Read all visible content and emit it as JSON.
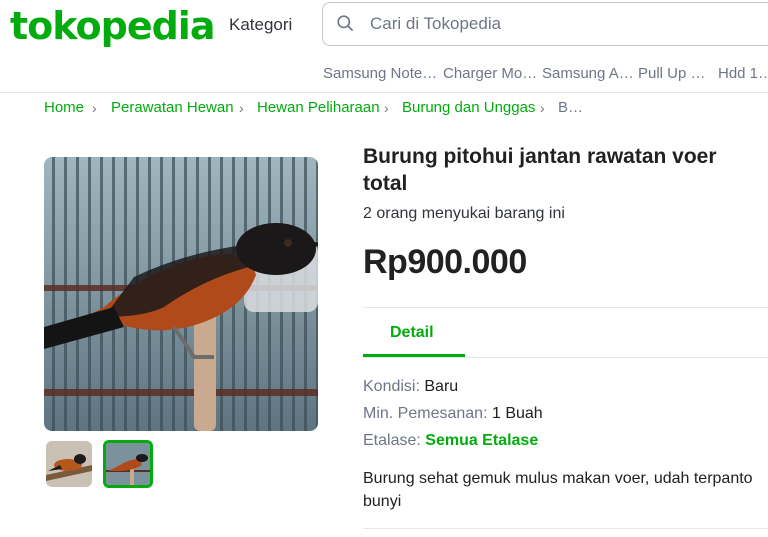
{
  "header": {
    "logo": "tokopedia",
    "kategori": "Kategori",
    "search_placeholder": "Cari di Tokopedia",
    "suggestions": [
      "Samsung Note…",
      "Charger Mo…",
      "Samsung A…",
      "Pull Up …",
      "Hdd 1…"
    ]
  },
  "breadcrumb": {
    "items": [
      "Home",
      "Perawatan Hewan",
      "Hewan Peliharaan",
      "Burung dan Unggas"
    ],
    "current": "B…"
  },
  "product": {
    "title": "Burung pitohui jantan rawatan voer total",
    "likes": "2 orang menyukai barang ini",
    "price": "Rp900.000",
    "tab": "Detail",
    "condition_label": "Kondisi:",
    "condition_value": "Baru",
    "min_order_label": "Min. Pemesanan:",
    "min_order_value": "1 Buah",
    "etalase_label": "Etalase:",
    "etalase_value": "Semua Etalase",
    "description": "Burung sehat gemuk mulus makan voer, udah terpanto bunyi"
  },
  "colors": {
    "brand": "#03ac0e",
    "text_primary": "#212121",
    "text_secondary": "#6d7588",
    "border": "#e4e7ec"
  }
}
